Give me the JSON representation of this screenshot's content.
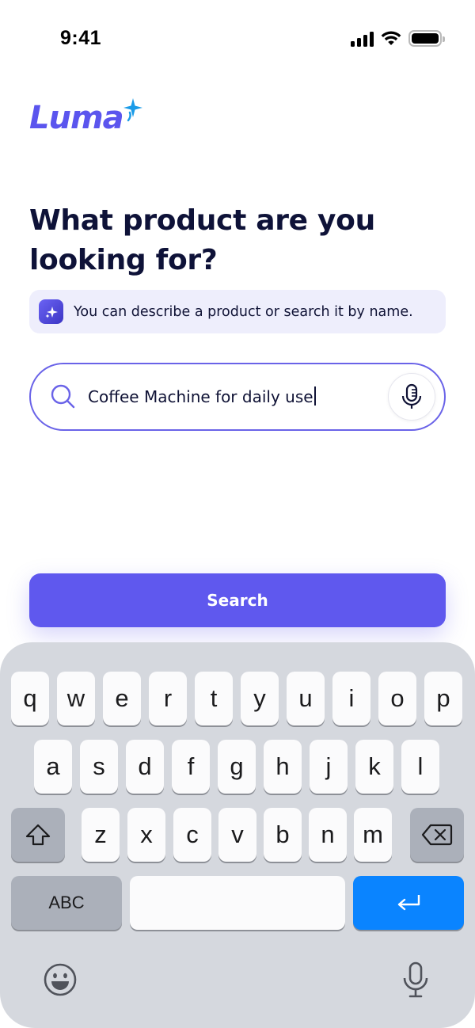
{
  "status_bar": {
    "time": "9:41"
  },
  "logo": {
    "text": "Luma"
  },
  "page": {
    "title": "What product are you looking for?"
  },
  "hint": {
    "text": "You can describe a product or search it by name."
  },
  "search": {
    "value": "Coffee Machine for daily use"
  },
  "search_button": {
    "label": "Search"
  },
  "keyboard": {
    "row1": [
      "q",
      "w",
      "e",
      "r",
      "t",
      "y",
      "u",
      "i",
      "o",
      "p"
    ],
    "row2": [
      "a",
      "s",
      "d",
      "f",
      "g",
      "h",
      "j",
      "k",
      "l"
    ],
    "row3": [
      "z",
      "x",
      "c",
      "v",
      "b",
      "n",
      "m"
    ],
    "mode_label": "ABC",
    "icons": [
      "shift-icon",
      "delete-icon",
      "return-icon",
      "emoji-icon",
      "dictation-icon"
    ]
  },
  "colors": {
    "accent": "#5f58ee",
    "hint_bg": "#eeeefc",
    "keyboard_bg": "#d5d8de",
    "return_key": "#0a84ff"
  }
}
